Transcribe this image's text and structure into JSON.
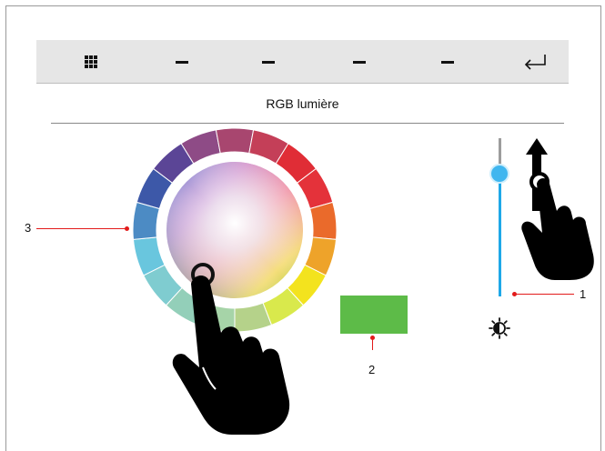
{
  "toolbar": {
    "buttons": [
      {
        "name": "grid-menu-button",
        "icon": "grid-icon"
      },
      {
        "name": "toolbar-dash-1",
        "icon": "dash-icon"
      },
      {
        "name": "toolbar-dash-2",
        "icon": "dash-icon"
      },
      {
        "name": "toolbar-dash-3",
        "icon": "dash-icon"
      },
      {
        "name": "toolbar-dash-4",
        "icon": "dash-icon"
      },
      {
        "name": "return-button",
        "icon": "return-arrow-icon"
      }
    ]
  },
  "page": {
    "title": "RGB lumière"
  },
  "callouts": {
    "brightness_slider": "1",
    "color_preview": "2",
    "color_wheel": "3"
  },
  "color_preview": {
    "color": "#5dbb48"
  },
  "slider": {
    "level": 0.83,
    "track_color": "#1ea8e8",
    "icon": "brightness-icon"
  },
  "color_wheel": {
    "segments": [
      "#8e4b86",
      "#a8466f",
      "#c43f58",
      "#e02d36",
      "#e4323a",
      "#ea6a2b",
      "#eea32a",
      "#f3e31e",
      "#d9e94c",
      "#b5d28a",
      "#a6d4a8",
      "#93cfb9",
      "#7fccd0",
      "#69c6de",
      "#4c8bc4",
      "#3d58a8",
      "#5b4596"
    ],
    "selected_color": "#5dbb48"
  },
  "gestures": {
    "wheel_gesture": "tap-hand-icon",
    "slider_gesture": "swipe-up-hand-icon"
  }
}
